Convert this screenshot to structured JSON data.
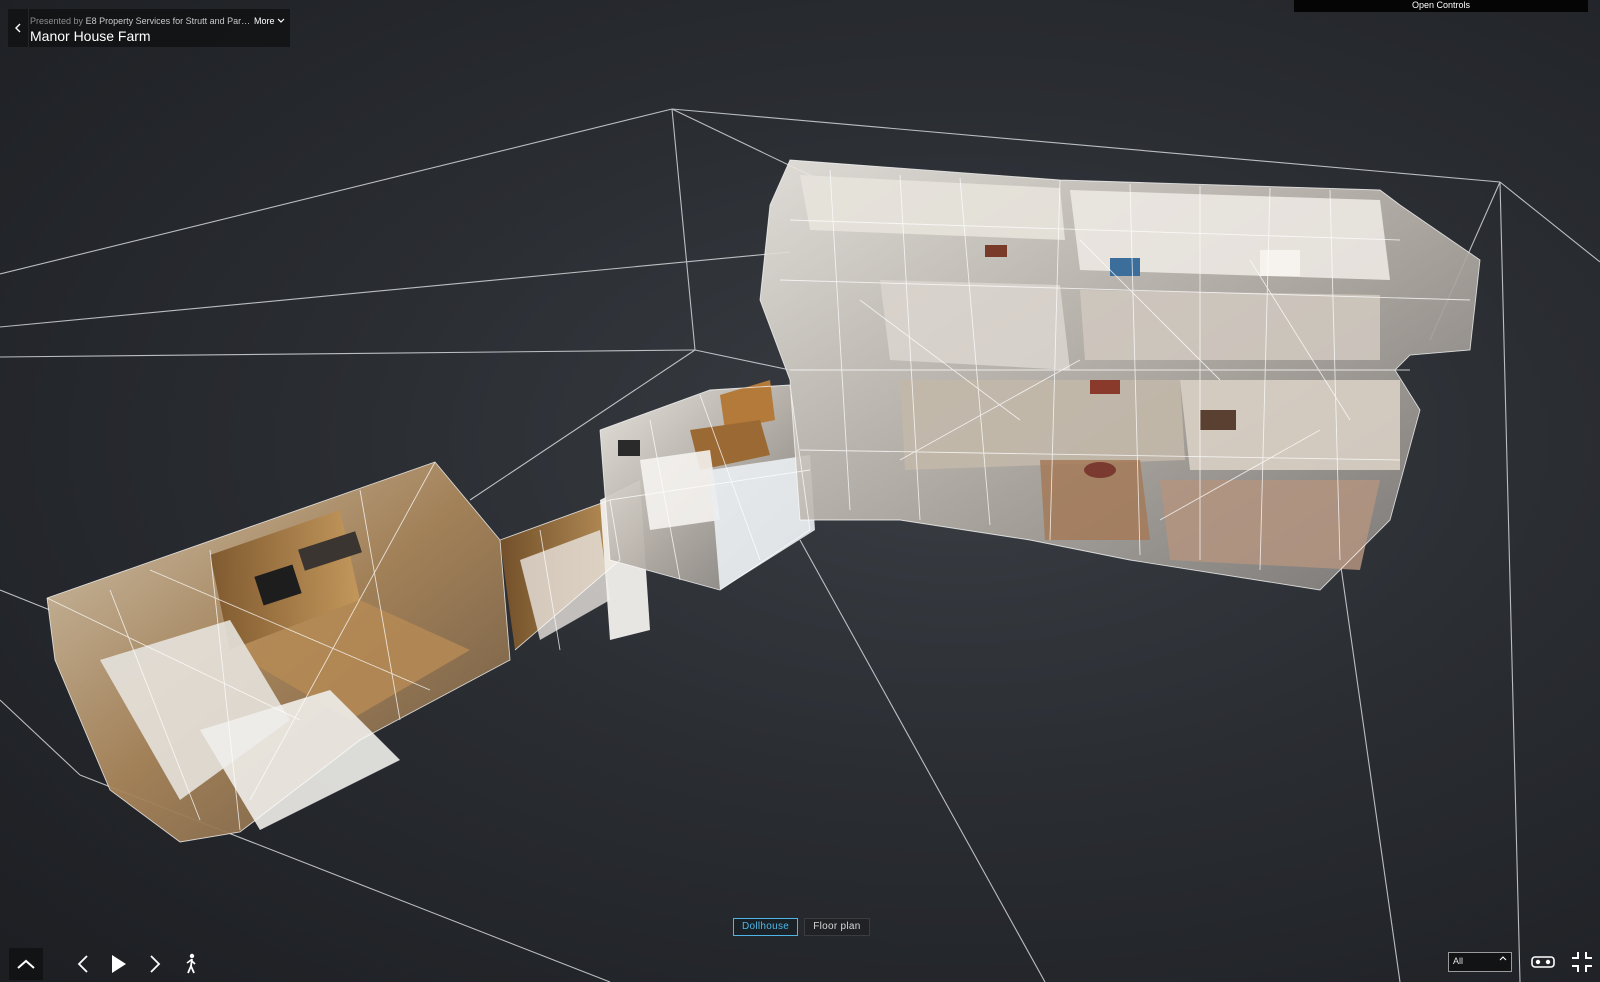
{
  "header": {
    "presented_prefix": "Presented by",
    "presented_by": "E8 Property Services for Strutt and Par…",
    "title": "Manor House Farm",
    "more_label": "More"
  },
  "top_right": {
    "open_controls_label": "Open Controls"
  },
  "view_modes": {
    "dollhouse_label": "Dollhouse",
    "floorplan_label": "Floor plan",
    "active": "dollhouse"
  },
  "floor_selector": {
    "selected": "All"
  },
  "icons": {
    "back": "chevron-left-icon",
    "more": "chevron-down-icon",
    "expand": "chevron-up-icon",
    "prev": "chevron-left-icon",
    "play": "play-icon",
    "next": "chevron-right-icon",
    "walk": "walking-person-icon",
    "vr": "vr-headset-icon",
    "fullscreen": "exit-fullscreen-icon"
  },
  "colors": {
    "background": "#2a2d32",
    "accent": "#4fb5e6",
    "wireframe": "#d7d9dc"
  }
}
